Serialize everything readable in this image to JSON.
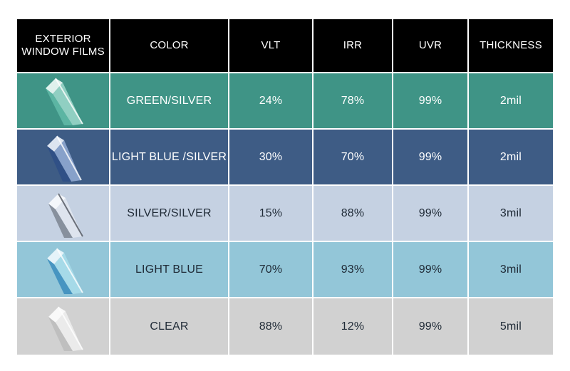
{
  "header": {
    "col0": "EXTERIOR\nWINDOW FILMS",
    "col1": "COLOR",
    "col2": "VLT",
    "col3": "IRR",
    "col4": "UVR",
    "col5": "THICKNESS"
  },
  "rows": [
    {
      "color": "GREEN/SILVER",
      "vlt": "24%",
      "irr": "78%",
      "uvr": "99%",
      "thickness": "2mil",
      "bg": "#3f9486",
      "icon": "film-roll-green-icon"
    },
    {
      "color": "LIGHT BLUE /SILVER",
      "vlt": "30%",
      "irr": "70%",
      "uvr": "99%",
      "thickness": "2mil",
      "bg": "#3e5c85",
      "icon": "film-roll-blue-icon"
    },
    {
      "color": "SILVER/SILVER",
      "vlt": "15%",
      "irr": "88%",
      "uvr": "99%",
      "thickness": "3mil",
      "bg": "#c5d1e2",
      "icon": "film-roll-silver-icon"
    },
    {
      "color": "LIGHT BLUE",
      "vlt": "70%",
      "irr": "93%",
      "uvr": "99%",
      "thickness": "3mil",
      "bg": "#93c6d8",
      "icon": "film-roll-light-blue-icon"
    },
    {
      "color": "CLEAR",
      "vlt": "88%",
      "irr": "12%",
      "uvr": "99%",
      "thickness": "5mil",
      "bg": "#d1d1d1",
      "icon": "film-roll-clear-icon"
    }
  ]
}
